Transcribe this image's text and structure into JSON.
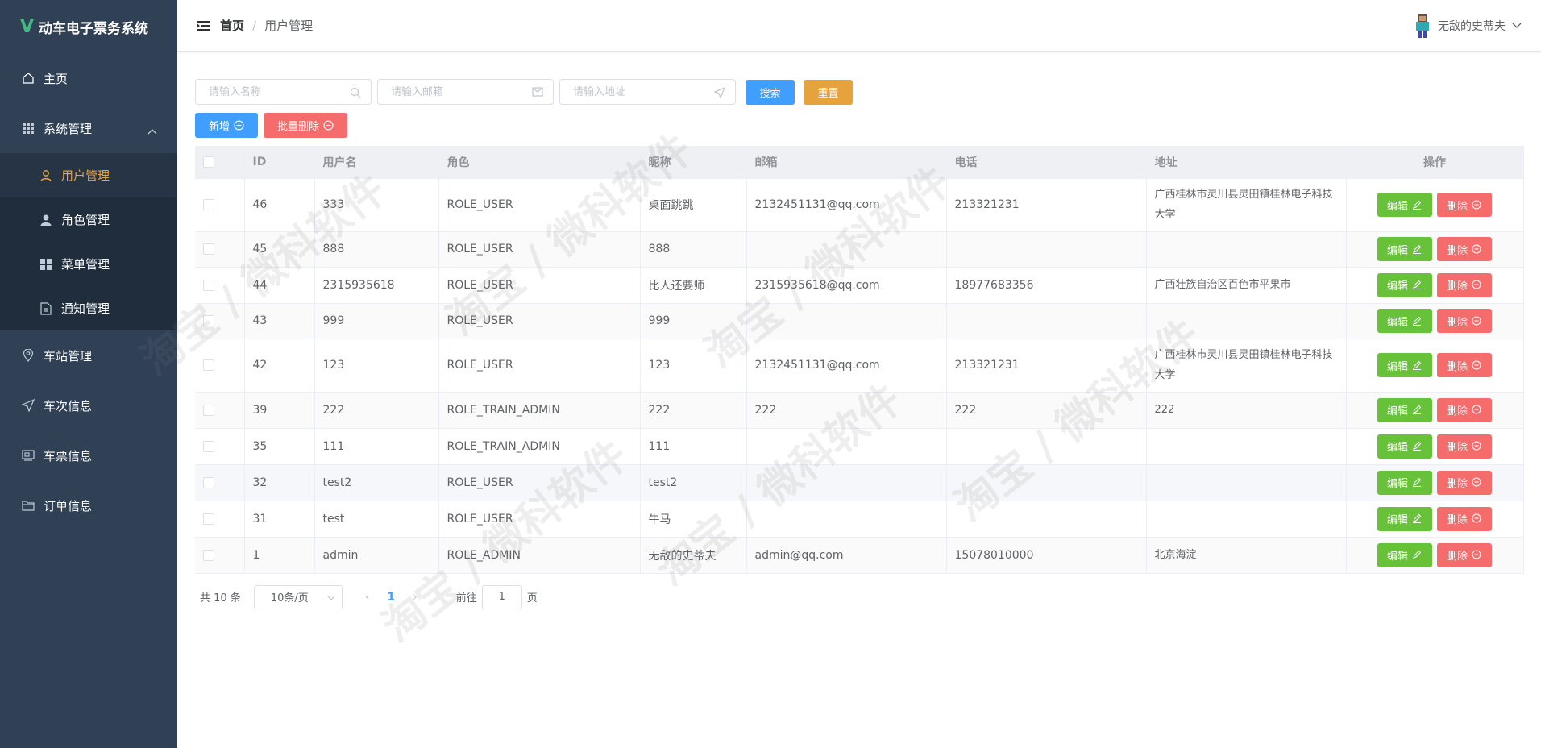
{
  "app": {
    "logo_mark": "V",
    "title": "动车电子票务系统"
  },
  "sidebar": {
    "items": [
      {
        "label": "主页",
        "icon": "home-icon"
      },
      {
        "label": "系统管理",
        "icon": "grid-icon",
        "expanded": true,
        "children": [
          {
            "label": "用户管理",
            "icon": "user-icon",
            "active": true
          },
          {
            "label": "角色管理",
            "icon": "person-icon"
          },
          {
            "label": "菜单管理",
            "icon": "menu-grid-icon"
          },
          {
            "label": "通知管理",
            "icon": "document-icon"
          }
        ]
      },
      {
        "label": "车站管理",
        "icon": "location-icon"
      },
      {
        "label": "车次信息",
        "icon": "send-icon"
      },
      {
        "label": "车票信息",
        "icon": "ticket-icon"
      },
      {
        "label": "订单信息",
        "icon": "folder-icon"
      }
    ]
  },
  "header": {
    "breadcrumb_home": "首页",
    "breadcrumb_sep": "/",
    "breadcrumb_current": "用户管理",
    "username": "无敌的史蒂夫"
  },
  "filters": {
    "name_placeholder": "请输入名称",
    "email_placeholder": "请输入邮箱",
    "address_placeholder": "请输入地址",
    "search_label": "搜索",
    "reset_label": "重置"
  },
  "actions": {
    "add_label": "新增",
    "batch_delete_label": "批量删除"
  },
  "table": {
    "columns": [
      "ID",
      "用户名",
      "角色",
      "昵称",
      "邮箱",
      "电话",
      "地址",
      "操作"
    ],
    "edit_label": "编辑",
    "delete_label": "删除",
    "rows": [
      {
        "id": "46",
        "username": "333",
        "role": "ROLE_USER",
        "nickname": "桌面跳跳",
        "email": "2132451131@qq.com",
        "phone": "213321231",
        "address": "广西桂林市灵川县灵田镇桂林电子科技大学"
      },
      {
        "id": "45",
        "username": "888",
        "role": "ROLE_USER",
        "nickname": "888",
        "email": "",
        "phone": "",
        "address": ""
      },
      {
        "id": "44",
        "username": "2315935618",
        "role": "ROLE_USER",
        "nickname": "比人还要师",
        "email": "2315935618@qq.com",
        "phone": "18977683356",
        "address": "广西壮族自治区百色市平果市"
      },
      {
        "id": "43",
        "username": "999",
        "role": "ROLE_USER",
        "nickname": "999",
        "email": "",
        "phone": "",
        "address": ""
      },
      {
        "id": "42",
        "username": "123",
        "role": "ROLE_USER",
        "nickname": "123",
        "email": "2132451131@qq.com",
        "phone": "213321231",
        "address": "广西桂林市灵川县灵田镇桂林电子科技大学"
      },
      {
        "id": "39",
        "username": "222",
        "role": "ROLE_TRAIN_ADMIN",
        "nickname": "222",
        "email": "222",
        "phone": "222",
        "address": "222"
      },
      {
        "id": "35",
        "username": "111",
        "role": "ROLE_TRAIN_ADMIN",
        "nickname": "111",
        "email": "",
        "phone": "",
        "address": ""
      },
      {
        "id": "32",
        "username": "test2",
        "role": "ROLE_USER",
        "nickname": "test2",
        "email": "",
        "phone": "",
        "address": ""
      },
      {
        "id": "31",
        "username": "test",
        "role": "ROLE_USER",
        "nickname": "牛马",
        "email": "",
        "phone": "",
        "address": ""
      },
      {
        "id": "1",
        "username": "admin",
        "role": "ROLE_ADMIN",
        "nickname": "无敌的史蒂夫",
        "email": "admin@qq.com",
        "phone": "15078010000",
        "address": "北京海淀"
      }
    ]
  },
  "pagination": {
    "total_text": "共 10 条",
    "page_size": "10条/页",
    "prev": "‹",
    "current_page": "1",
    "next": "›",
    "goto_prefix": "前往",
    "goto_value": "1",
    "goto_suffix": "页"
  },
  "watermark": {
    "text": "淘宝 / 微科软件"
  },
  "colors": {
    "sidebar_bg": "#304156",
    "active_menu": "#f4a52e",
    "primary": "#409eff",
    "success": "#67c23a",
    "danger": "#f56c6c",
    "warning": "#e6a23c"
  }
}
